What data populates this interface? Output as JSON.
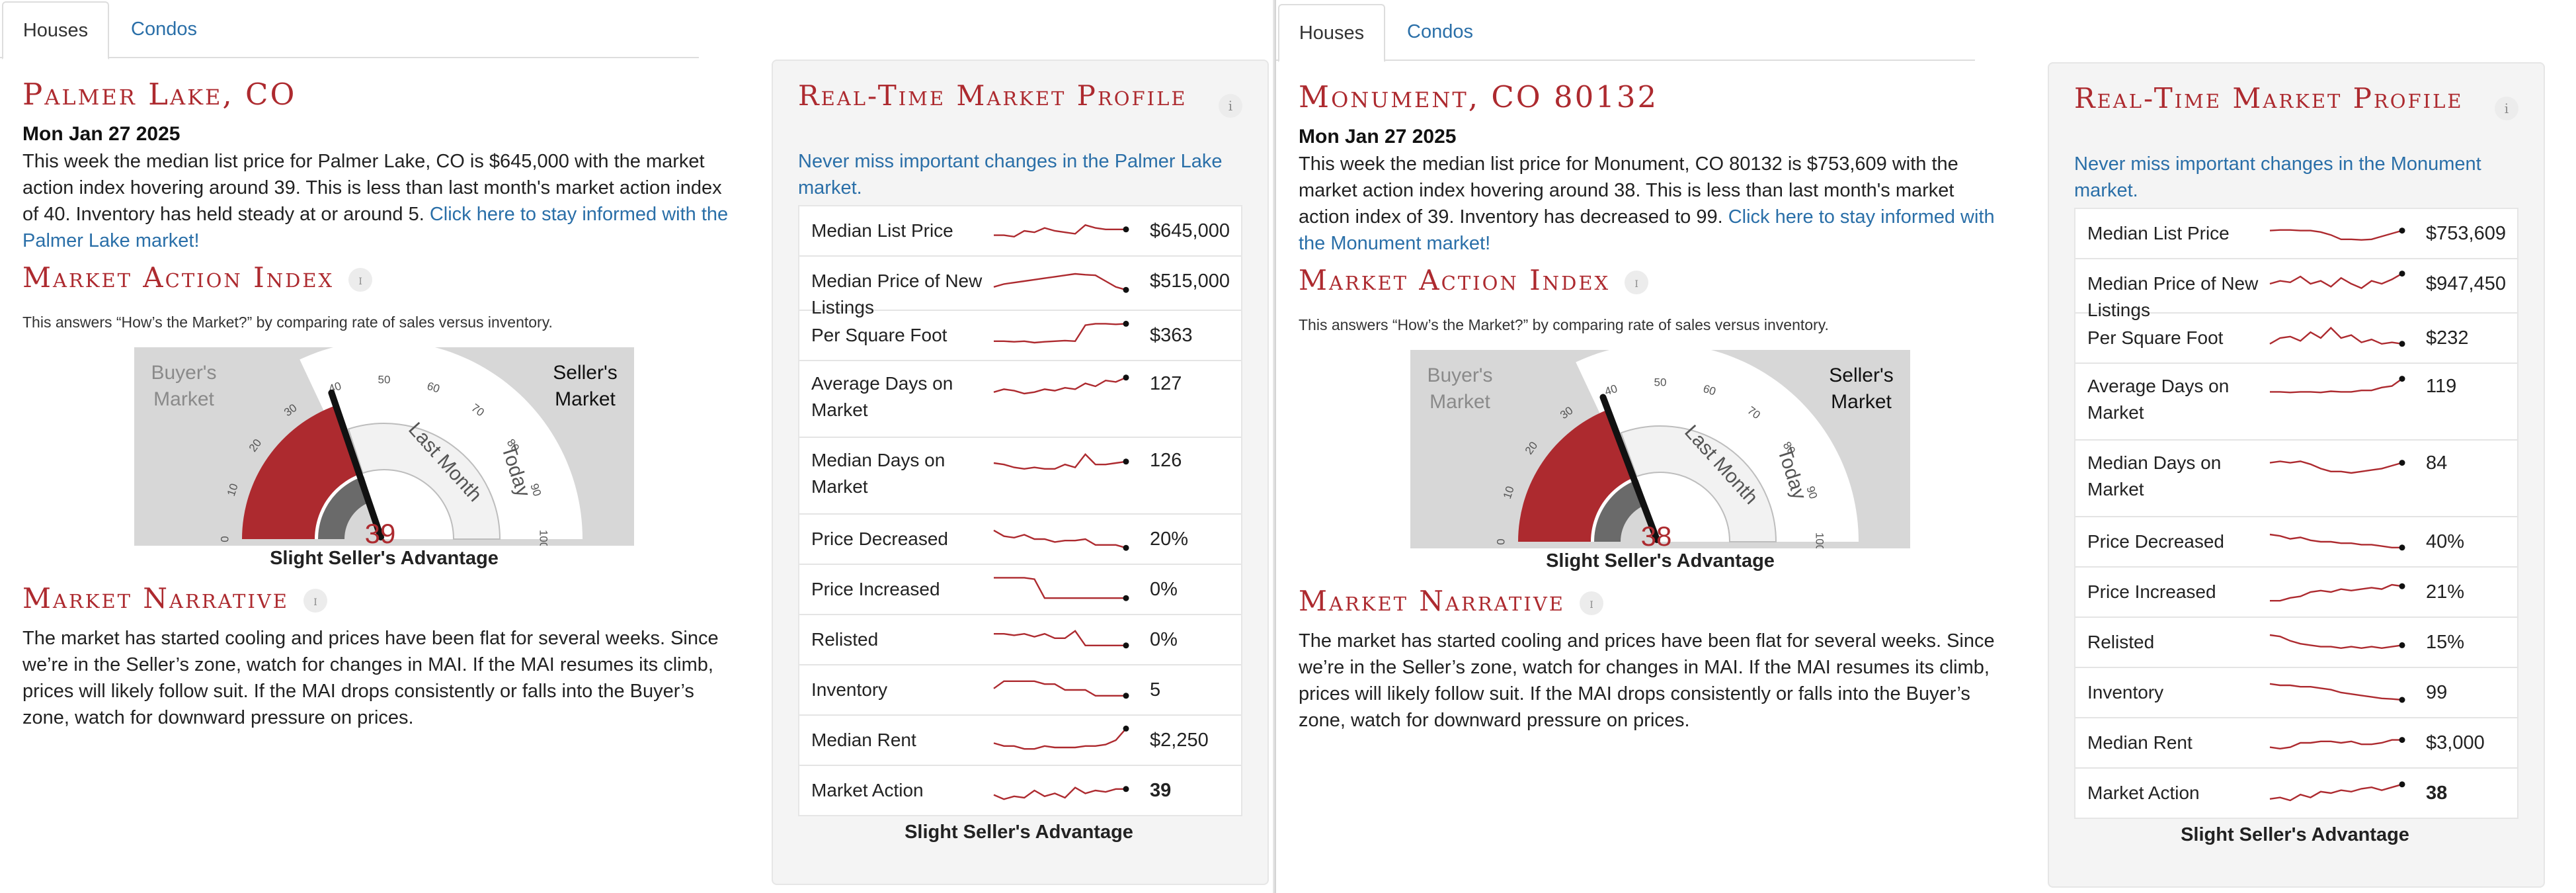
{
  "panels": [
    {
      "tabs": {
        "houses": "Houses",
        "condos": "Condos"
      },
      "location": "Palmer Lake, CO",
      "date": "Mon Jan 27 2025",
      "intro_text": "This week the median list price for Palmer Lake, CO is $645,000 with the market action index hovering around 39. This is less than last month's market action index of 40. Inventory has held steady at or around 5. ",
      "intro_link": "Click here to stay informed with the Palmer Lake market!",
      "mai_title": "Market Action Index",
      "mai_note": "This answers “How’s the Market?” by comparing rate of sales versus inventory.",
      "gauge": {
        "buyers_label": [
          "Buyer's",
          "Market"
        ],
        "sellers_label": [
          "Seller's",
          "Market"
        ],
        "ticks": [
          "0",
          "10",
          "20",
          "30",
          "40",
          "50",
          "60",
          "70",
          "80",
          "90",
          "100"
        ],
        "value": 39,
        "last_month_value": 40,
        "last_month_label": "Last Month",
        "today_label": "Today",
        "caption": "Slight Seller's Advantage"
      },
      "narrative_title": "Market Narrative",
      "narrative_text": "The market has started cooling and prices have been flat for several weeks. Since we’re in the Seller’s zone, watch for changes in MAI. If the MAI resumes its climb, prices will likely follow suit. If the MAI drops consistently or falls into the Buyer’s zone, watch for downward pressure on prices.",
      "profile": {
        "title": "Real-Time Market Profile",
        "link": "Never miss important changes in the Palmer Lake market.",
        "rows": [
          {
            "label": "Median List Price",
            "value": "$645,000",
            "trend": [
              0.35,
              0.35,
              0.3,
              0.5,
              0.45,
              0.6,
              0.5,
              0.45,
              0.4,
              0.7,
              0.6,
              0.55,
              0.55,
              0.55
            ]
          },
          {
            "label": "Median Price of New Listings",
            "value": "$515,000",
            "trend": [
              0.3,
              0.4,
              0.45,
              0.5,
              0.55,
              0.6,
              0.65,
              0.7,
              0.75,
              0.72,
              0.7,
              0.5,
              0.3,
              0.2
            ]
          },
          {
            "label": "Per Square Foot",
            "value": "$363",
            "trend": [
              0.3,
              0.3,
              0.28,
              0.3,
              0.25,
              0.28,
              0.3,
              0.32,
              0.3,
              0.85,
              0.9,
              0.9,
              0.88,
              0.9
            ]
          },
          {
            "label": "Average Days on Market",
            "value": "127",
            "trend": [
              0.3,
              0.4,
              0.35,
              0.25,
              0.3,
              0.4,
              0.35,
              0.45,
              0.4,
              0.6,
              0.5,
              0.7,
              0.65,
              0.8
            ]
          },
          {
            "label": "Median Days on Market",
            "value": "126",
            "trend": [
              0.5,
              0.45,
              0.35,
              0.3,
              0.35,
              0.3,
              0.3,
              0.45,
              0.35,
              0.8,
              0.45,
              0.45,
              0.5,
              0.55
            ]
          },
          {
            "label": "Price Decreased",
            "value": "20%",
            "trend": [
              0.8,
              0.6,
              0.55,
              0.65,
              0.5,
              0.5,
              0.4,
              0.45,
              0.45,
              0.5,
              0.3,
              0.3,
              0.3,
              0.2
            ]
          },
          {
            "label": "Price Increased",
            "value": "0%",
            "trend": [
              0.9,
              0.9,
              0.9,
              0.9,
              0.85,
              0.2,
              0.2,
              0.2,
              0.2,
              0.2,
              0.2,
              0.2,
              0.2,
              0.2
            ]
          },
          {
            "label": "Relisted",
            "value": "0%",
            "trend": [
              0.7,
              0.7,
              0.65,
              0.7,
              0.6,
              0.7,
              0.55,
              0.55,
              0.8,
              0.3,
              0.3,
              0.3,
              0.3,
              0.3
            ]
          },
          {
            "label": "Inventory",
            "value": "5",
            "trend": [
              0.55,
              0.8,
              0.8,
              0.8,
              0.8,
              0.7,
              0.7,
              0.5,
              0.5,
              0.5,
              0.3,
              0.3,
              0.3,
              0.3
            ]
          },
          {
            "label": "Median Rent",
            "value": "$2,250",
            "trend": [
              0.4,
              0.3,
              0.3,
              0.2,
              0.2,
              0.3,
              0.25,
              0.25,
              0.25,
              0.3,
              0.3,
              0.35,
              0.5,
              0.9
            ]
          },
          {
            "label": "Market Action",
            "value": "39",
            "bold": true,
            "trend": [
              0.35,
              0.2,
              0.3,
              0.25,
              0.5,
              0.3,
              0.4,
              0.25,
              0.6,
              0.4,
              0.5,
              0.45,
              0.55,
              0.55
            ]
          }
        ],
        "caption": "Slight Seller's Advantage"
      }
    },
    {
      "tabs": {
        "houses": "Houses",
        "condos": "Condos"
      },
      "location": "Monument, CO 80132",
      "date": "Mon Jan 27 2025",
      "intro_text": "This week the median list price for Monument, CO 80132 is $753,609 with the market action index hovering around 38. This is less than last month's market action index of 39. Inventory has decreased to 99. ",
      "intro_link": "Click here to stay informed with the Monument market!",
      "mai_title": "Market Action Index",
      "mai_note": "This answers “How’s the Market?” by comparing rate of sales versus inventory.",
      "gauge": {
        "buyers_label": [
          "Buyer's",
          "Market"
        ],
        "sellers_label": [
          "Seller's",
          "Market"
        ],
        "ticks": [
          "0",
          "10",
          "20",
          "30",
          "40",
          "50",
          "60",
          "70",
          "80",
          "90",
          "100"
        ],
        "value": 38,
        "last_month_value": 39,
        "last_month_label": "Last Month",
        "today_label": "Today",
        "caption": "Slight Seller's Advantage"
      },
      "narrative_title": "Market Narrative",
      "narrative_text": "The market has started cooling and prices have been flat for several weeks. Since we’re in the Seller’s zone, watch for changes in MAI. If the MAI resumes its climb, prices will likely follow suit. If the MAI drops consistently or falls into the Buyer’s zone, watch for downward pressure on prices.",
      "profile": {
        "title": "Real-Time Market Profile",
        "link": "Never miss important changes in the Monument market.",
        "rows": [
          {
            "label": "Median List Price",
            "value": "$753,609",
            "trend": [
              0.6,
              0.62,
              0.62,
              0.6,
              0.6,
              0.55,
              0.45,
              0.3,
              0.3,
              0.28,
              0.3,
              0.4,
              0.5,
              0.6
            ]
          },
          {
            "label": "Median Price of New Listings",
            "value": "$947,450",
            "trend": [
              0.5,
              0.6,
              0.55,
              0.75,
              0.5,
              0.6,
              0.4,
              0.7,
              0.5,
              0.35,
              0.6,
              0.5,
              0.65,
              0.85
            ]
          },
          {
            "label": "Per Square Foot",
            "value": "$232",
            "trend": [
              0.3,
              0.5,
              0.55,
              0.4,
              0.7,
              0.5,
              0.85,
              0.5,
              0.6,
              0.35,
              0.45,
              0.3,
              0.35,
              0.3
            ]
          },
          {
            "label": "Average Days on Market",
            "value": "119",
            "trend": [
              0.4,
              0.4,
              0.38,
              0.4,
              0.4,
              0.38,
              0.42,
              0.4,
              0.4,
              0.45,
              0.45,
              0.55,
              0.6,
              0.85
            ]
          },
          {
            "label": "Median Days on Market",
            "value": "84",
            "trend": [
              0.6,
              0.65,
              0.6,
              0.65,
              0.55,
              0.4,
              0.3,
              0.3,
              0.25,
              0.3,
              0.35,
              0.4,
              0.5,
              0.6
            ]
          },
          {
            "label": "Price Decreased",
            "value": "40%",
            "trend": [
              0.75,
              0.7,
              0.6,
              0.65,
              0.55,
              0.5,
              0.5,
              0.45,
              0.45,
              0.4,
              0.4,
              0.35,
              0.3,
              0.3
            ]
          },
          {
            "label": "Price Increased",
            "value": "21%",
            "trend": [
              0.2,
              0.2,
              0.3,
              0.35,
              0.5,
              0.55,
              0.5,
              0.6,
              0.55,
              0.6,
              0.65,
              0.6,
              0.75,
              0.7
            ]
          },
          {
            "label": "Relisted",
            "value": "15%",
            "trend": [
              0.75,
              0.7,
              0.55,
              0.45,
              0.4,
              0.35,
              0.35,
              0.3,
              0.35,
              0.3,
              0.35,
              0.3,
              0.35,
              0.4
            ]
          },
          {
            "label": "Inventory",
            "value": "99",
            "trend": [
              0.8,
              0.75,
              0.75,
              0.7,
              0.7,
              0.65,
              0.6,
              0.5,
              0.45,
              0.4,
              0.35,
              0.3,
              0.28,
              0.25
            ]
          },
          {
            "label": "Median Rent",
            "value": "$3,000",
            "trend": [
              0.35,
              0.3,
              0.35,
              0.5,
              0.5,
              0.55,
              0.55,
              0.5,
              0.55,
              0.45,
              0.45,
              0.5,
              0.6,
              0.6
            ]
          },
          {
            "label": "Market Action",
            "value": "38",
            "bold": true,
            "trend": [
              0.3,
              0.35,
              0.25,
              0.45,
              0.35,
              0.55,
              0.5,
              0.6,
              0.55,
              0.65,
              0.7,
              0.6,
              0.7,
              0.8
            ]
          }
        ],
        "caption": "Slight Seller's Advantage"
      }
    }
  ],
  "colors": {
    "brand_red": "#ad2a2f",
    "link_blue": "#2a6fa8",
    "gauge_grey": "#6a6a6a",
    "gauge_bg": "#d7d7d7"
  }
}
